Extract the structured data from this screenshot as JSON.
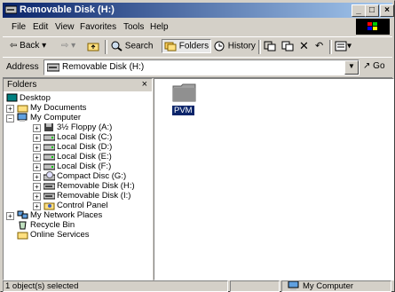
{
  "window": {
    "title": "Removable Disk (H:)"
  },
  "menu": [
    {
      "label": "File"
    },
    {
      "label": "Edit"
    },
    {
      "label": "View"
    },
    {
      "label": "Favorites"
    },
    {
      "label": "Tools"
    },
    {
      "label": "Help"
    }
  ],
  "toolbar": {
    "back": "Back",
    "search": "Search",
    "folders": "Folders",
    "history": "History"
  },
  "address": {
    "label": "Address",
    "value": "Removable Disk (H:)",
    "go": "Go"
  },
  "folders_pane": {
    "title": "Folders",
    "tree": [
      {
        "label": "Desktop",
        "icon": "desktop-icon"
      },
      {
        "label": "My Documents",
        "icon": "folder-icon"
      },
      {
        "label": "My Computer",
        "icon": "computer-icon"
      },
      {
        "label": "3½ Floppy (A:)",
        "icon": "floppy-icon"
      },
      {
        "label": "Local Disk (C:)",
        "icon": "drive-icon"
      },
      {
        "label": "Local Disk (D:)",
        "icon": "drive-icon"
      },
      {
        "label": "Local Disk (E:)",
        "icon": "drive-icon"
      },
      {
        "label": "Local Disk (F:)",
        "icon": "drive-icon"
      },
      {
        "label": "Compact Disc (G:)",
        "icon": "cd-icon"
      },
      {
        "label": "Removable Disk (H:)",
        "icon": "removable-icon"
      },
      {
        "label": "Removable Disk (I:)",
        "icon": "removable-icon"
      },
      {
        "label": "Control Panel",
        "icon": "control-panel-icon"
      },
      {
        "label": "My Network Places",
        "icon": "network-icon"
      },
      {
        "label": "Recycle Bin",
        "icon": "recycle-bin-icon"
      },
      {
        "label": "Online Services",
        "icon": "folder-icon"
      }
    ]
  },
  "content": {
    "items": [
      {
        "label": "PVM",
        "icon": "folder-icon",
        "selected": true
      }
    ]
  },
  "status": {
    "left": "1 object(s) selected",
    "right": "My Computer"
  }
}
